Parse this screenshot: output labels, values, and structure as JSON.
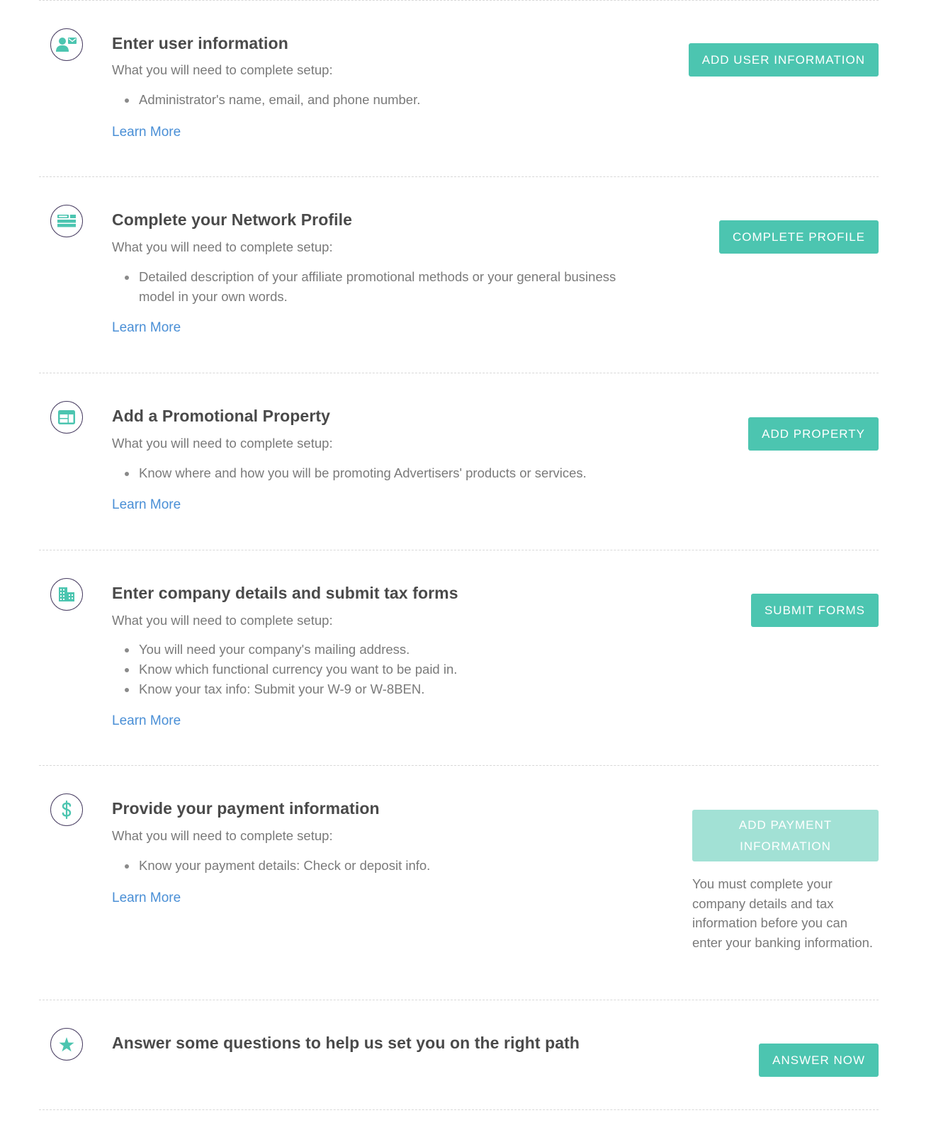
{
  "accent_color": "#4cc5b0",
  "disabled_color": "#a2e1d5",
  "link_color": "#4a8fd6",
  "steps": [
    {
      "icon": "user-mail-icon",
      "title": "Enter user information",
      "subtitle": "What you will need to complete setup:",
      "requirements": [
        "Administrator's name, email, and phone number."
      ],
      "learn_more": "Learn More",
      "button": "ADD USER INFORMATION"
    },
    {
      "icon": "profile-card-icon",
      "title": "Complete your Network Profile",
      "subtitle": "What you will need to complete setup:",
      "requirements": [
        "Detailed description of your affiliate promotional methods or your general business model in your own words."
      ],
      "learn_more": "Learn More",
      "button": "COMPLETE PROFILE"
    },
    {
      "icon": "browser-window-icon",
      "title": "Add a Promotional Property",
      "subtitle": "What you will need to complete setup:",
      "requirements": [
        "Know where and how you will be promoting Advertisers' products or services."
      ],
      "learn_more": "Learn More",
      "button": "ADD PROPERTY"
    },
    {
      "icon": "building-icon",
      "title": "Enter company details and submit tax forms",
      "subtitle": "What you will need to complete setup:",
      "requirements": [
        "You will need your company's mailing address.",
        "Know which functional currency you want to be paid in.",
        "Know your tax info: Submit your W-9 or W-8BEN."
      ],
      "learn_more": "Learn More",
      "button": "SUBMIT FORMS"
    },
    {
      "icon": "dollar-icon",
      "title": "Provide your payment information",
      "subtitle": "What you will need to complete setup:",
      "requirements": [
        "Know your payment details: Check or deposit info."
      ],
      "learn_more": "Learn More",
      "button": "ADD PAYMENT INFORMATION",
      "button_disabled": true,
      "note": "You must complete your company details and tax information before you can enter your banking information."
    },
    {
      "icon": "star-icon",
      "title": "Answer some questions to help us set you on the right path",
      "button": "ANSWER NOW"
    }
  ]
}
